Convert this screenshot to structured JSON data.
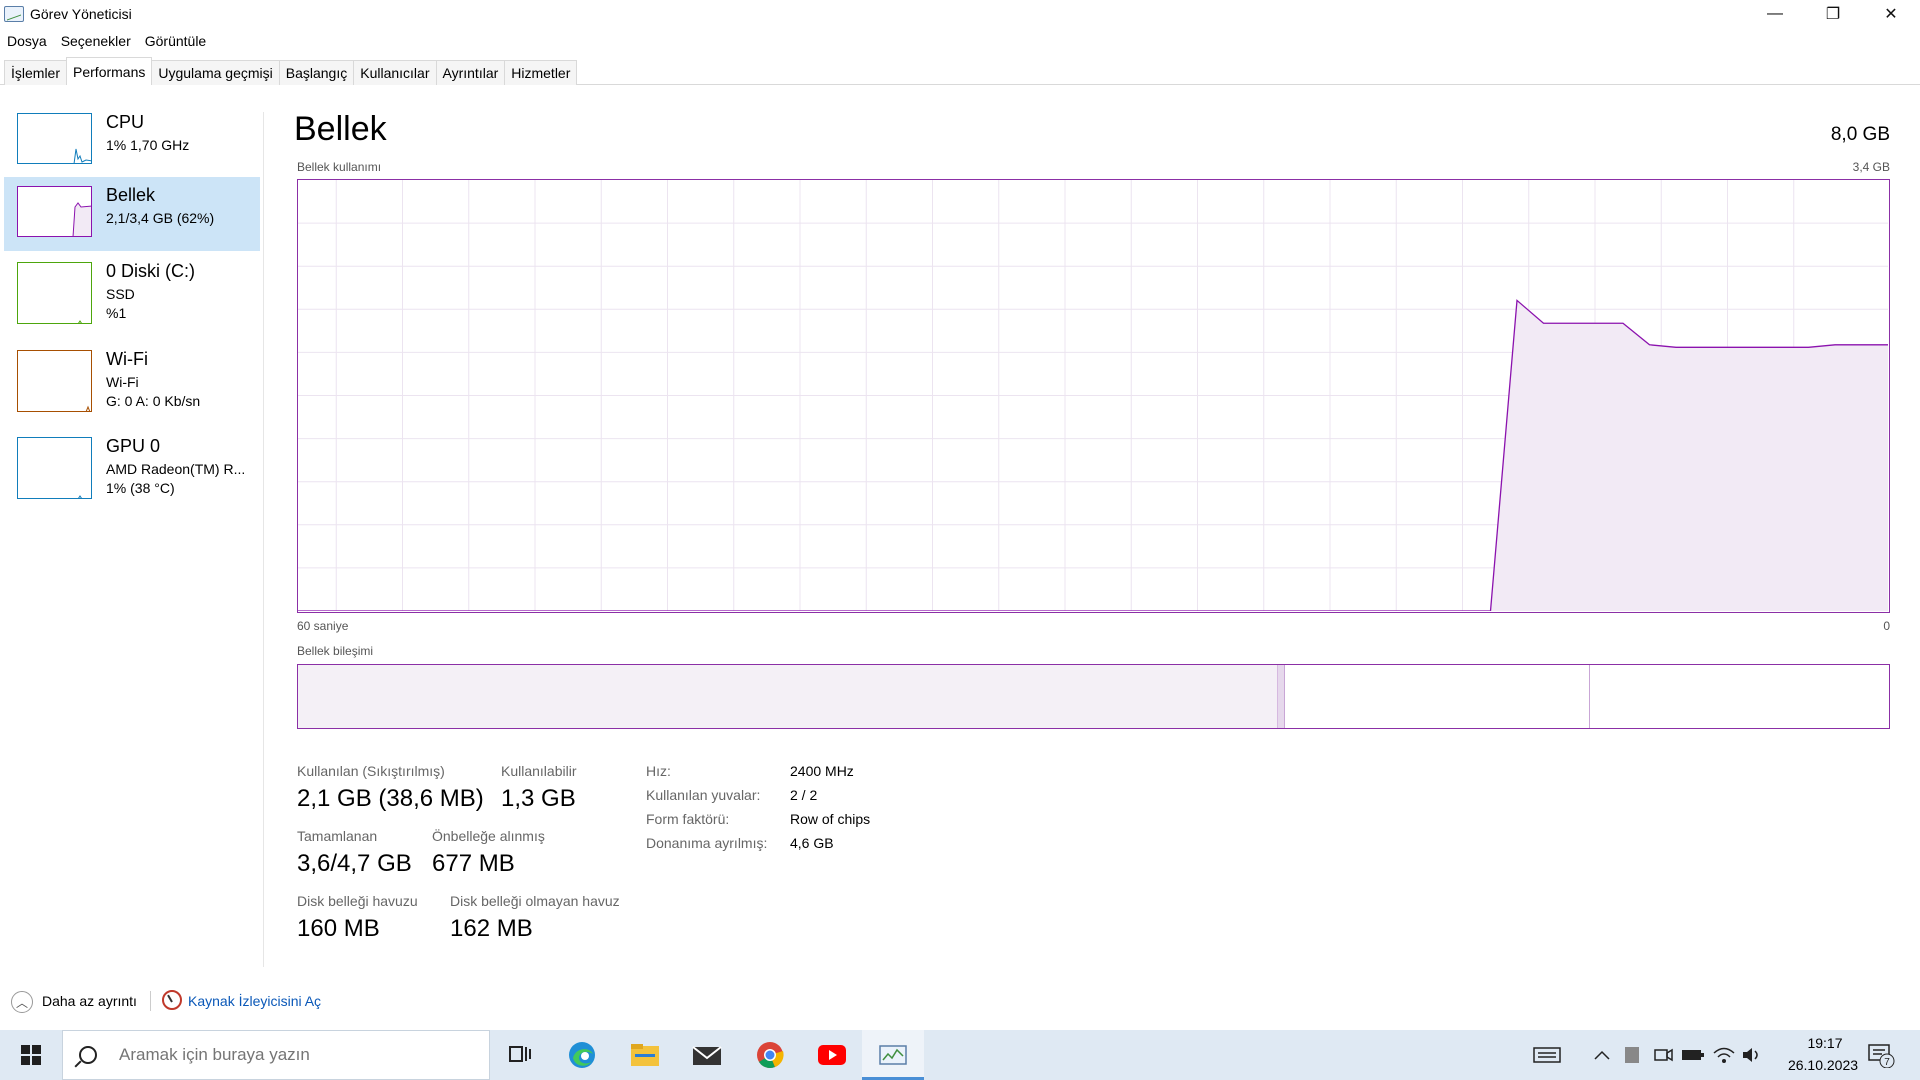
{
  "window": {
    "title": "Görev Yöneticisi",
    "controls": {
      "minimize": "—",
      "restore": "❐",
      "close": "✕"
    }
  },
  "menu": [
    "Dosya",
    "Seçenekler",
    "Görüntüle"
  ],
  "tabs": [
    "İşlemler",
    "Performans",
    "Uygulama geçmişi",
    "Başlangıç",
    "Kullanıcılar",
    "Ayrıntılar",
    "Hizmetler"
  ],
  "active_tab": "Performans",
  "sidebar": {
    "items": [
      {
        "name": "CPU",
        "sub1": "1% 1,70 GHz",
        "sub2": "",
        "color": "#117dbb"
      },
      {
        "name": "Bellek",
        "sub1": "2,1/3,4 GB (62%)",
        "sub2": "",
        "color": "#8b12ae"
      },
      {
        "name": "0 Diski (C:)",
        "sub1": "SSD",
        "sub2": "%1",
        "color": "#4da60c"
      },
      {
        "name": "Wi-Fi",
        "sub1": "Wi-Fi",
        "sub2": "G: 0 A: 0 Kb/sn",
        "color": "#a74f01"
      },
      {
        "name": "GPU 0",
        "sub1": "AMD Radeon(TM) R...",
        "sub2": "1% (38 °C)",
        "color": "#117dbb"
      }
    ],
    "selected": "Bellek"
  },
  "main": {
    "title": "Bellek",
    "total": "8,0 GB",
    "usage_label": "Bellek kullanımı",
    "usage_max": "3,4 GB",
    "axis_left": "60 saniye",
    "axis_right": "0",
    "composition_label": "Bellek bileşimi"
  },
  "chart_data": {
    "type": "area",
    "title": "Bellek kullanımı",
    "xlabel": "",
    "ylabel": "",
    "x_range_label": [
      "60 saniye",
      "0"
    ],
    "ylim": [
      0,
      3.4
    ],
    "y_unit": "GB",
    "grid": true,
    "color": "#8b12ae",
    "x": [
      60,
      59,
      58,
      57,
      56,
      55,
      54,
      53,
      52,
      51,
      50,
      49,
      48,
      47,
      46,
      45,
      44,
      43,
      42,
      41,
      40,
      39,
      38,
      37,
      36,
      35,
      34,
      33,
      32,
      31,
      30,
      29,
      28,
      27,
      26,
      25,
      24,
      23,
      22,
      21,
      20,
      19,
      18,
      17,
      16,
      15,
      14,
      13,
      12,
      11,
      10,
      9,
      8,
      7,
      6,
      5,
      4,
      3,
      2,
      1,
      0
    ],
    "values": [
      0,
      0,
      0,
      0,
      0,
      0,
      0,
      0,
      0,
      0,
      0,
      0,
      0,
      0,
      0,
      0,
      0,
      0,
      0,
      0,
      0,
      0,
      0,
      0,
      0,
      0,
      0,
      0,
      0,
      0,
      0,
      0,
      0,
      0,
      0,
      0,
      0,
      0,
      0,
      0,
      0,
      0,
      0,
      0,
      0,
      0,
      2.45,
      2.27,
      2.27,
      2.27,
      2.27,
      2.1,
      2.08,
      2.08,
      2.08,
      2.08,
      2.08,
      2.08,
      2.1,
      2.1,
      2.1
    ]
  },
  "stats": {
    "used_label": "Kullanılan (Sıkıştırılmış)",
    "used_value": "2,1 GB (38,6 MB)",
    "available_label": "Kullanılabilir",
    "available_value": "1,3 GB",
    "committed_label": "Tamamlanan",
    "committed_value": "3,6/4,7 GB",
    "cached_label": "Önbelleğe alınmış",
    "cached_value": "677 MB",
    "paged_label": "Disk belleği havuzu",
    "paged_value": "160 MB",
    "nonpaged_label": "Disk belleği olmayan havuz",
    "nonpaged_value": "162 MB"
  },
  "specs": [
    {
      "label": "Hız:",
      "value": "2400 MHz"
    },
    {
      "label": "Kullanılan yuvalar:",
      "value": "2 / 2"
    },
    {
      "label": "Form faktörü:",
      "value": "Row of chips"
    },
    {
      "label": "Donanıma ayrılmış:",
      "value": "4,6 GB"
    }
  ],
  "footer": {
    "fewer_details": "Daha az ayrıntı",
    "resource_monitor": "Kaynak İzleyicisini Aç"
  },
  "taskbar": {
    "search_placeholder": "Aramak için buraya yazın",
    "time": "19:17",
    "date": "26.10.2023",
    "notification_count": "7"
  }
}
